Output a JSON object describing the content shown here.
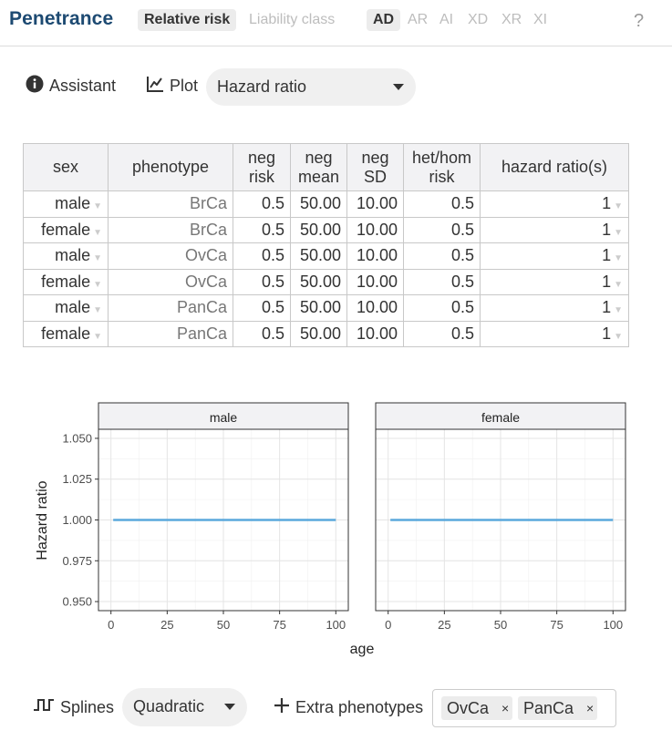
{
  "header": {
    "title": "Penetrance",
    "mode_tabs": [
      "Relative risk",
      "Liability class"
    ],
    "active_mode": "Relative risk",
    "inheritance": [
      "AD",
      "AR",
      "AI",
      "XD",
      "XR",
      "XI"
    ],
    "active_inheritance": "AD",
    "help": "?"
  },
  "controls": {
    "assistant_label": "Assistant",
    "plot_label": "Plot",
    "plot_select": "Hazard ratio"
  },
  "table": {
    "columns": [
      "sex",
      "phenotype",
      "neg risk",
      "neg mean",
      "neg SD",
      "het/hom risk",
      "hazard ratio(s)"
    ],
    "rows": [
      [
        "male",
        "BrCa",
        "0.5",
        "50.00",
        "10.00",
        "0.5",
        "1"
      ],
      [
        "female",
        "BrCa",
        "0.5",
        "50.00",
        "10.00",
        "0.5",
        "1"
      ],
      [
        "male",
        "OvCa",
        "0.5",
        "50.00",
        "10.00",
        "0.5",
        "1"
      ],
      [
        "female",
        "OvCa",
        "0.5",
        "50.00",
        "10.00",
        "0.5",
        "1"
      ],
      [
        "male",
        "PanCa",
        "0.5",
        "50.00",
        "10.00",
        "0.5",
        "1"
      ],
      [
        "female",
        "PanCa",
        "0.5",
        "50.00",
        "10.00",
        "0.5",
        "1"
      ]
    ]
  },
  "chart_data": {
    "type": "line",
    "panels": [
      "male",
      "female"
    ],
    "xlabel": "age",
    "ylabel": "Hazard ratio",
    "xlim": [
      0,
      100
    ],
    "ylim": [
      0.95,
      1.05
    ],
    "xticks": [
      "0",
      "25",
      "50",
      "75",
      "100"
    ],
    "yticks": [
      "0.950",
      "0.975",
      "1.000",
      "1.025",
      "1.050"
    ],
    "series": [
      {
        "panel": "male",
        "x": [
          1,
          100
        ],
        "y": [
          1.0,
          1.0
        ],
        "color": "#5aa8dc"
      },
      {
        "panel": "female",
        "x": [
          1,
          100
        ],
        "y": [
          1.0,
          1.0
        ],
        "color": "#5aa8dc"
      }
    ],
    "grid": true
  },
  "footer": {
    "splines_label": "Splines",
    "splines_select": "Quadratic",
    "extra_label": "Extra phenotypes",
    "extra_tags": [
      "OvCa",
      "PanCa"
    ],
    "tag_remove": "×"
  },
  "colors": {
    "brand": "#1d4a72",
    "line": "#5aa8dc"
  }
}
